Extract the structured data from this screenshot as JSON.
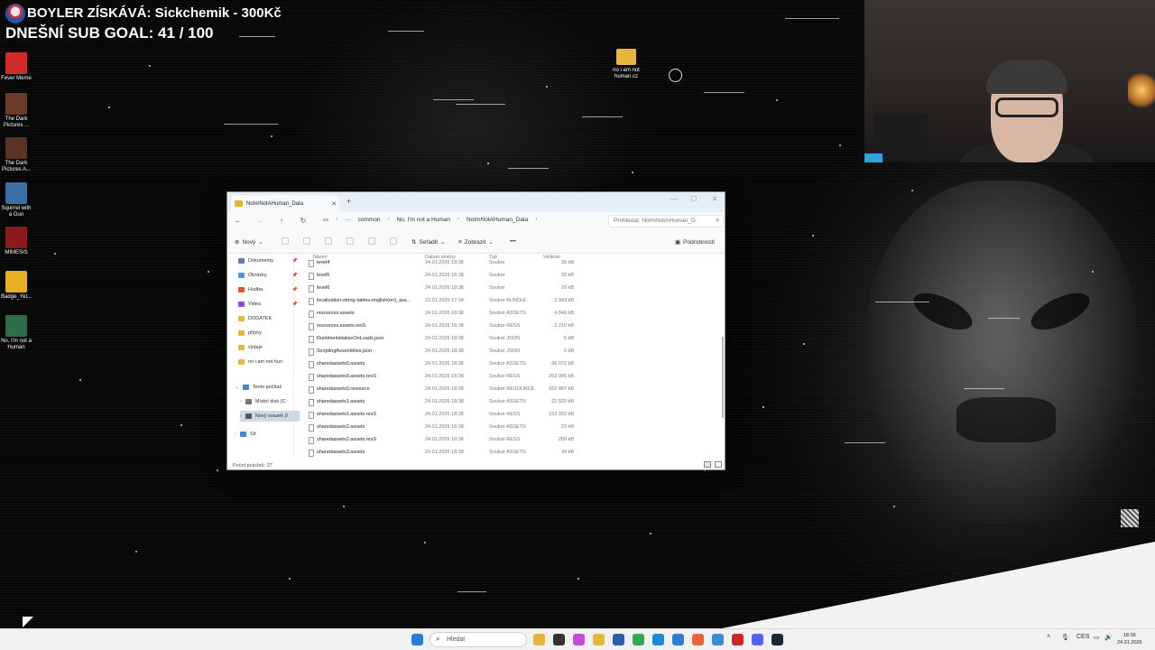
{
  "overlay": {
    "donation": "BOYLER ZÍSKÁVÁ: Sickchemik - 300Kč",
    "sub_goal": "DNEŠNÍ SUB GOAL: 41 / 100"
  },
  "desktop_icons": [
    {
      "label": "Fever Meme",
      "color": "#d12b2b"
    },
    {
      "label": "The Dark Pictures ...",
      "color": "#6b3a2a"
    },
    {
      "label": "The Dark Pictures A...",
      "color": "#5a3326"
    },
    {
      "label": "Squirrel with a Gun",
      "color": "#3a6ea5"
    },
    {
      "label": "MIMESIS",
      "color": "#8b1a1a"
    },
    {
      "label": "Badge_Yel...",
      "color": "#e6b020"
    },
    {
      "label": "No, I'm not a Human",
      "color": "#2e6d4a"
    }
  ],
  "top_folder": {
    "label": "no i am not human.cz"
  },
  "explorer": {
    "tab_title": "NoImNotAHuman_Data",
    "breadcrumbs": [
      "common",
      "No, I'm not a Human",
      "NoImNotAHuman_Data"
    ],
    "search_placeholder": "Prohledat: NoImNotAHuman_D",
    "toolbar": {
      "new": "Nový",
      "sort": "Seřadit",
      "view": "Zobrazit",
      "more": "•••",
      "details": "Podrobnosti"
    },
    "sidebar": [
      {
        "label": "Dokumenty",
        "pinned": true,
        "color": "#5b7fb5"
      },
      {
        "label": "Obrázky",
        "pinned": true,
        "color": "#4a9bd1"
      },
      {
        "label": "Hudba",
        "pinned": true,
        "color": "#e0553a"
      },
      {
        "label": "Videa",
        "pinned": true,
        "color": "#8a4fc5"
      },
      {
        "label": "DODATEK",
        "pinned": false,
        "color": "#e8b53c"
      },
      {
        "label": "příjmy",
        "pinned": false,
        "color": "#e8b53c"
      },
      {
        "label": "výdaje",
        "pinned": false,
        "color": "#e8b53c"
      },
      {
        "label": "no i am not hun",
        "pinned": false,
        "color": "#e8b53c"
      },
      {
        "label": "Tento počítač",
        "pinned": false,
        "color": "#3a8ad6"
      },
      {
        "label": "Místní disk (C:",
        "pinned": false,
        "color": "#777777"
      },
      {
        "label": "Nový svazek (I",
        "pinned": false,
        "color": "#555555"
      },
      {
        "label": "Síť",
        "pinned": false,
        "color": "#3a8ad6"
      }
    ],
    "columns": {
      "name": "Název",
      "date": "Datum změny",
      "type": "Typ",
      "size": "Velikost"
    },
    "rows": [
      {
        "name": "level4",
        "date": "24.01.2026 18:38",
        "type": "Soubor",
        "size": "30 kB"
      },
      {
        "name": "level5",
        "date": "24.01.2026 18:38",
        "type": "Soubor",
        "size": "28 kB"
      },
      {
        "name": "level6",
        "date": "24.01.2026 18:38",
        "type": "Soubor",
        "size": "29 kB"
      },
      {
        "name": "localization-string-tables-english(en)_ass...",
        "date": "22.01.2026 17:34",
        "type": "Soubor BUNDLE",
        "size": "2 343 kB"
      },
      {
        "name": "resources.assets",
        "date": "24.01.2026 18:38",
        "type": "Soubor ASSETS",
        "size": "4 840 kB"
      },
      {
        "name": "resources.assets.resS",
        "date": "24.01.2026 18:38",
        "type": "Soubor RESS",
        "size": "2 210 kB"
      },
      {
        "name": "RuntimeInitializeOnLoads.json",
        "date": "24.01.2026 18:38",
        "type": "Soubor JSON",
        "size": "6 kB"
      },
      {
        "name": "ScriptingAssemblies.json",
        "date": "24.01.2026 18:38",
        "type": "Soubor JSON",
        "size": "6 kB"
      },
      {
        "name": "sharedassets0.assets",
        "date": "24.01.2026 18:38",
        "type": "Soubor ASSETS",
        "size": "86 072 kB"
      },
      {
        "name": "sharedassets0.assets.resS",
        "date": "24.01.2026 18:38",
        "type": "Soubor RESS",
        "size": "263 985 kB"
      },
      {
        "name": "sharedassets0.resource",
        "date": "24.01.2026 18:38",
        "type": "Soubor RESOURCE",
        "size": "552 487 kB"
      },
      {
        "name": "sharedassets1.assets",
        "date": "24.01.2026 18:38",
        "type": "Soubor ASSETS",
        "size": "21 920 kB"
      },
      {
        "name": "sharedassets1.assets.resS",
        "date": "24.01.2026 18:38",
        "type": "Soubor RESS",
        "size": "153 902 kB"
      },
      {
        "name": "sharedassets2.assets",
        "date": "24.01.2026 18:38",
        "type": "Soubor ASSETS",
        "size": "23 kB"
      },
      {
        "name": "sharedassets2.assets.resS",
        "date": "24.01.2026 18:38",
        "type": "Soubor RESS",
        "size": "280 kB"
      },
      {
        "name": "sharedassets3.assets",
        "date": "24.01.2026 18:38",
        "type": "Soubor ASSETS",
        "size": "34 kB"
      }
    ],
    "status": "Počet položek: 37"
  },
  "taskbar": {
    "search_placeholder": "Hledat",
    "language": "CES",
    "time": "18:38",
    "date": "24.01.2026",
    "apps": [
      {
        "icon": "file-explorer-icon",
        "color": "#e8b53c"
      },
      {
        "icon": "task-view-icon",
        "color": "#333333"
      },
      {
        "icon": "color-app-icon",
        "color": "#c94ad8"
      },
      {
        "icon": "folder-icon",
        "color": "#e8b53c"
      },
      {
        "icon": "calculator-icon",
        "color": "#2b5fa8"
      },
      {
        "icon": "chrome-icon",
        "color": "#34a853"
      },
      {
        "icon": "edge-icon",
        "color": "#1c8ad8"
      },
      {
        "icon": "app-blue-icon",
        "color": "#2a7fd4"
      },
      {
        "icon": "firefox-icon",
        "color": "#e8643a"
      },
      {
        "icon": "gallery-icon",
        "color": "#3a8ad6"
      },
      {
        "icon": "app-red-icon",
        "color": "#c42a2a"
      },
      {
        "icon": "discord-icon",
        "color": "#5865f2"
      },
      {
        "icon": "steam-icon",
        "color": "#1b2838"
      }
    ]
  }
}
